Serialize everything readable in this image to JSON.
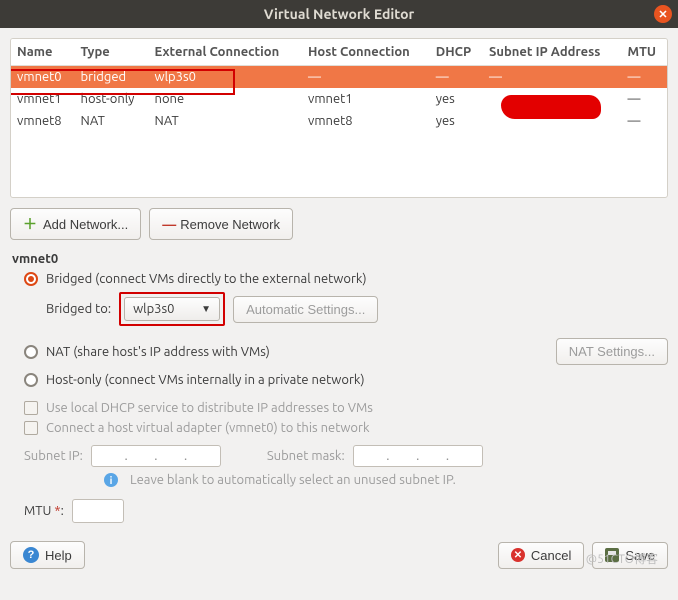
{
  "window": {
    "title": "Virtual Network Editor"
  },
  "table": {
    "headers": [
      "Name",
      "Type",
      "External Connection",
      "Host Connection",
      "DHCP",
      "Subnet IP Address",
      "MTU"
    ],
    "rows": [
      {
        "name": "vmnet0",
        "type": "bridged",
        "ext": "wlp3s0",
        "host": "—",
        "dhcp": "—",
        "subnet": "—",
        "mtu": "—",
        "selected": true
      },
      {
        "name": "vmnet1",
        "type": "host-only",
        "ext": "none",
        "host": "vmnet1",
        "dhcp": "yes",
        "subnet": "",
        "mtu": "—",
        "selected": false
      },
      {
        "name": "vmnet8",
        "type": "NAT",
        "ext": "NAT",
        "host": "vmnet8",
        "dhcp": "yes",
        "subnet": "",
        "mtu": "—",
        "selected": false
      }
    ]
  },
  "toolbar": {
    "add_label": "Add Network...",
    "remove_label": "Remove Network"
  },
  "editor": {
    "current": "vmnet0",
    "bridged_label": "Bridged (connect VMs directly to the external network)",
    "bridged_to_label": "Bridged to:",
    "bridged_to_value": "wlp3s0",
    "auto_settings_label": "Automatic Settings...",
    "nat_label": "NAT (share host's IP address with VMs)",
    "nat_settings_label": "NAT Settings...",
    "hostonly_label": "Host-only (connect VMs internally in a private network)",
    "dhcp_chk_label": "Use local DHCP service to distribute IP addresses to VMs",
    "hostadapter_chk_label": "Connect a host virtual adapter (vmnet0) to this network",
    "subnet_ip_label": "Subnet IP:",
    "subnet_mask_label": "Subnet mask:",
    "hint": "Leave blank to automatically select an unused subnet IP.",
    "mtu_label": "MTU",
    "mtu_required": "*",
    "mtu_colon": ":"
  },
  "footer": {
    "help_label": "Help",
    "cancel_label": "Cancel",
    "save_label": "Save"
  },
  "watermark": "@51CTO博客"
}
